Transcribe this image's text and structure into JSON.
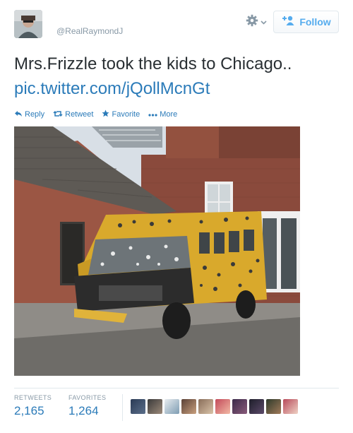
{
  "header": {
    "handle": "@RealRaymondJ",
    "follow_label": "Follow"
  },
  "tweet": {
    "text": "Mrs.Frizzle took the kids to Chicago..",
    "link": "pic.twitter.com/jQollMcnGt"
  },
  "actions": {
    "reply": "Reply",
    "retweet": "Retweet",
    "favorite": "Favorite",
    "more": "More"
  },
  "stats": {
    "retweets_label": "RETWEETS",
    "retweets_count": "2,165",
    "favorites_label": "FAVORITES",
    "favorites_count": "1,264"
  },
  "colors": {
    "link": "#2b7bb9",
    "accent": "#55acee",
    "muted": "#8899a6",
    "text": "#292f33"
  },
  "icons": [
    "gear-icon",
    "chevron-down-icon",
    "add-user-icon",
    "reply-icon",
    "retweet-icon",
    "star-icon",
    "more-dots-icon"
  ]
}
